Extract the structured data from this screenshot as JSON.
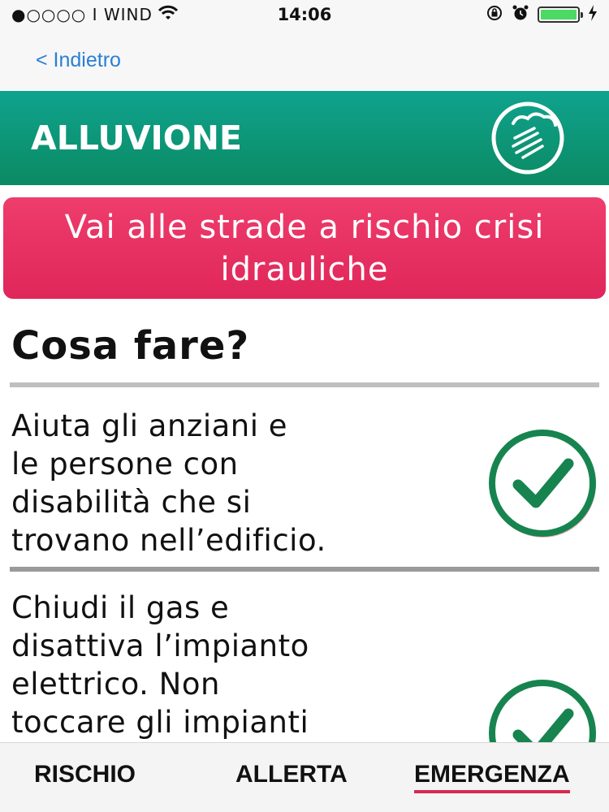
{
  "status_bar": {
    "carrier": "●○○○○ I WIND",
    "time": "14:06",
    "battery_level": 1.0,
    "icons": [
      "wifi-icon",
      "rotation-lock-icon",
      "alarm-icon",
      "battery-icon",
      "charging-icon"
    ]
  },
  "nav": {
    "back_label": "< Indietro"
  },
  "header": {
    "title": "ALLUVIONE",
    "icon": "rain-cloud-icon",
    "color": "#0b9a78"
  },
  "risk_button": {
    "label": "Vai alle strade a rischio crisi idrauliche",
    "color": "#e8325f"
  },
  "section": {
    "heading": "Cosa fare?"
  },
  "actions": [
    {
      "text": "Aiuta gli anziani e\nle persone con\ndisabilità che si\ntrovano nell’edificio.",
      "icon": "check-icon"
    },
    {
      "text": "Chiudi il gas e\ndisattiva l’impianto\nelettrico. Non\ntoccare gli impianti",
      "icon": "check-icon"
    }
  ],
  "tabs": [
    {
      "label": "RISCHIO",
      "active": false
    },
    {
      "label": "ALLERTA",
      "active": false
    },
    {
      "label": "EMERGENZA",
      "active": true
    }
  ],
  "colors": {
    "accent_link": "#2a7fd4",
    "check_green": "#17844f",
    "check_ring_shadow": "#c8283f"
  }
}
